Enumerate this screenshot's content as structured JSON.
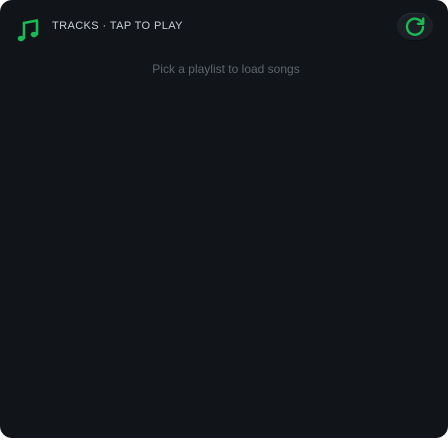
{
  "header": {
    "title": "TRACKS · TAP TO PLAY",
    "music_icon": "music-note-icon",
    "refresh_icon": "refresh-icon"
  },
  "content": {
    "empty_message": "Pick a playlist to load songs"
  },
  "colors": {
    "background": "#111418",
    "accent": "#1db954",
    "title_text": "#c9ced6",
    "muted_text": "#5d6570"
  }
}
